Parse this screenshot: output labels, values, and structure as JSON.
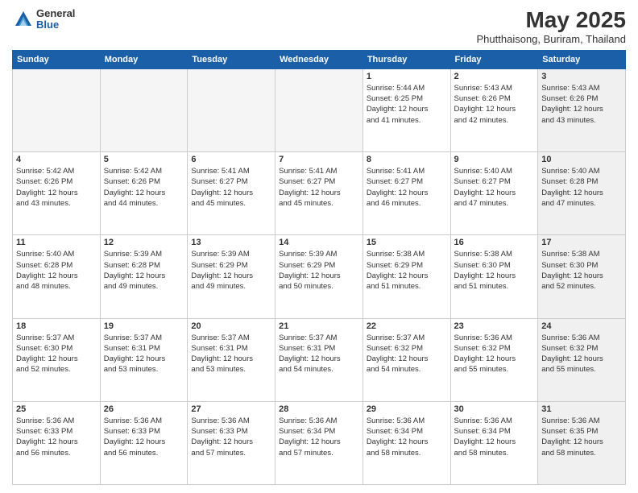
{
  "header": {
    "logo_general": "General",
    "logo_blue": "Blue",
    "title": "May 2025",
    "subtitle": "Phutthaisong, Buriram, Thailand"
  },
  "days_of_week": [
    "Sunday",
    "Monday",
    "Tuesday",
    "Wednesday",
    "Thursday",
    "Friday",
    "Saturday"
  ],
  "weeks": [
    [
      {
        "num": "",
        "info": "",
        "empty": true
      },
      {
        "num": "",
        "info": "",
        "empty": true
      },
      {
        "num": "",
        "info": "",
        "empty": true
      },
      {
        "num": "",
        "info": "",
        "empty": true
      },
      {
        "num": "1",
        "info": "Sunrise: 5:44 AM\nSunset: 6:25 PM\nDaylight: 12 hours\nand 41 minutes.",
        "empty": false,
        "shaded": false
      },
      {
        "num": "2",
        "info": "Sunrise: 5:43 AM\nSunset: 6:26 PM\nDaylight: 12 hours\nand 42 minutes.",
        "empty": false,
        "shaded": false
      },
      {
        "num": "3",
        "info": "Sunrise: 5:43 AM\nSunset: 6:26 PM\nDaylight: 12 hours\nand 43 minutes.",
        "empty": false,
        "shaded": true
      }
    ],
    [
      {
        "num": "4",
        "info": "Sunrise: 5:42 AM\nSunset: 6:26 PM\nDaylight: 12 hours\nand 43 minutes.",
        "empty": false,
        "shaded": false
      },
      {
        "num": "5",
        "info": "Sunrise: 5:42 AM\nSunset: 6:26 PM\nDaylight: 12 hours\nand 44 minutes.",
        "empty": false,
        "shaded": false
      },
      {
        "num": "6",
        "info": "Sunrise: 5:41 AM\nSunset: 6:27 PM\nDaylight: 12 hours\nand 45 minutes.",
        "empty": false,
        "shaded": false
      },
      {
        "num": "7",
        "info": "Sunrise: 5:41 AM\nSunset: 6:27 PM\nDaylight: 12 hours\nand 45 minutes.",
        "empty": false,
        "shaded": false
      },
      {
        "num": "8",
        "info": "Sunrise: 5:41 AM\nSunset: 6:27 PM\nDaylight: 12 hours\nand 46 minutes.",
        "empty": false,
        "shaded": false
      },
      {
        "num": "9",
        "info": "Sunrise: 5:40 AM\nSunset: 6:27 PM\nDaylight: 12 hours\nand 47 minutes.",
        "empty": false,
        "shaded": false
      },
      {
        "num": "10",
        "info": "Sunrise: 5:40 AM\nSunset: 6:28 PM\nDaylight: 12 hours\nand 47 minutes.",
        "empty": false,
        "shaded": true
      }
    ],
    [
      {
        "num": "11",
        "info": "Sunrise: 5:40 AM\nSunset: 6:28 PM\nDaylight: 12 hours\nand 48 minutes.",
        "empty": false,
        "shaded": false
      },
      {
        "num": "12",
        "info": "Sunrise: 5:39 AM\nSunset: 6:28 PM\nDaylight: 12 hours\nand 49 minutes.",
        "empty": false,
        "shaded": false
      },
      {
        "num": "13",
        "info": "Sunrise: 5:39 AM\nSunset: 6:29 PM\nDaylight: 12 hours\nand 49 minutes.",
        "empty": false,
        "shaded": false
      },
      {
        "num": "14",
        "info": "Sunrise: 5:39 AM\nSunset: 6:29 PM\nDaylight: 12 hours\nand 50 minutes.",
        "empty": false,
        "shaded": false
      },
      {
        "num": "15",
        "info": "Sunrise: 5:38 AM\nSunset: 6:29 PM\nDaylight: 12 hours\nand 51 minutes.",
        "empty": false,
        "shaded": false
      },
      {
        "num": "16",
        "info": "Sunrise: 5:38 AM\nSunset: 6:30 PM\nDaylight: 12 hours\nand 51 minutes.",
        "empty": false,
        "shaded": false
      },
      {
        "num": "17",
        "info": "Sunrise: 5:38 AM\nSunset: 6:30 PM\nDaylight: 12 hours\nand 52 minutes.",
        "empty": false,
        "shaded": true
      }
    ],
    [
      {
        "num": "18",
        "info": "Sunrise: 5:37 AM\nSunset: 6:30 PM\nDaylight: 12 hours\nand 52 minutes.",
        "empty": false,
        "shaded": false
      },
      {
        "num": "19",
        "info": "Sunrise: 5:37 AM\nSunset: 6:31 PM\nDaylight: 12 hours\nand 53 minutes.",
        "empty": false,
        "shaded": false
      },
      {
        "num": "20",
        "info": "Sunrise: 5:37 AM\nSunset: 6:31 PM\nDaylight: 12 hours\nand 53 minutes.",
        "empty": false,
        "shaded": false
      },
      {
        "num": "21",
        "info": "Sunrise: 5:37 AM\nSunset: 6:31 PM\nDaylight: 12 hours\nand 54 minutes.",
        "empty": false,
        "shaded": false
      },
      {
        "num": "22",
        "info": "Sunrise: 5:37 AM\nSunset: 6:32 PM\nDaylight: 12 hours\nand 54 minutes.",
        "empty": false,
        "shaded": false
      },
      {
        "num": "23",
        "info": "Sunrise: 5:36 AM\nSunset: 6:32 PM\nDaylight: 12 hours\nand 55 minutes.",
        "empty": false,
        "shaded": false
      },
      {
        "num": "24",
        "info": "Sunrise: 5:36 AM\nSunset: 6:32 PM\nDaylight: 12 hours\nand 55 minutes.",
        "empty": false,
        "shaded": true
      }
    ],
    [
      {
        "num": "25",
        "info": "Sunrise: 5:36 AM\nSunset: 6:33 PM\nDaylight: 12 hours\nand 56 minutes.",
        "empty": false,
        "shaded": false
      },
      {
        "num": "26",
        "info": "Sunrise: 5:36 AM\nSunset: 6:33 PM\nDaylight: 12 hours\nand 56 minutes.",
        "empty": false,
        "shaded": false
      },
      {
        "num": "27",
        "info": "Sunrise: 5:36 AM\nSunset: 6:33 PM\nDaylight: 12 hours\nand 57 minutes.",
        "empty": false,
        "shaded": false
      },
      {
        "num": "28",
        "info": "Sunrise: 5:36 AM\nSunset: 6:34 PM\nDaylight: 12 hours\nand 57 minutes.",
        "empty": false,
        "shaded": false
      },
      {
        "num": "29",
        "info": "Sunrise: 5:36 AM\nSunset: 6:34 PM\nDaylight: 12 hours\nand 58 minutes.",
        "empty": false,
        "shaded": false
      },
      {
        "num": "30",
        "info": "Sunrise: 5:36 AM\nSunset: 6:34 PM\nDaylight: 12 hours\nand 58 minutes.",
        "empty": false,
        "shaded": false
      },
      {
        "num": "31",
        "info": "Sunrise: 5:36 AM\nSunset: 6:35 PM\nDaylight: 12 hours\nand 58 minutes.",
        "empty": false,
        "shaded": true
      }
    ]
  ]
}
